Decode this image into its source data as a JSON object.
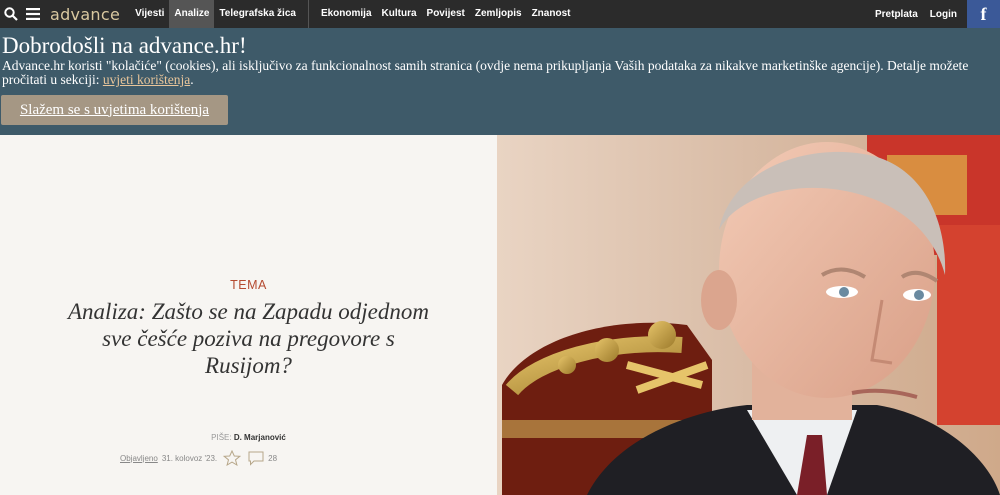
{
  "header": {
    "logo": "advance",
    "nav_main": [
      "Vijesti",
      "Analize",
      "Telegrafska žica"
    ],
    "nav_sections": [
      "Ekonomija",
      "Kultura",
      "Povijest",
      "Zemljopis",
      "Znanost"
    ],
    "nav_right": [
      "Pretplata",
      "Login"
    ],
    "facebook": "f"
  },
  "cookie": {
    "title": "Dobrodošli na advance.hr!",
    "text": "Advance.hr koristi \"kolačiće\" (cookies), ali isključivo za funkcionalnost samih stranica (ovdje nema prikupljanja Vaših podataka za nikakve marketinške agencije). Detalje možete pročitati u sekciji: ",
    "link": "uvjeti korištenja",
    "text_end": ".",
    "button": "Slažem se s uvjetima korištenja"
  },
  "article": {
    "tag": "TEMA",
    "headline": "Analiza: Zašto se na Zapadu odjednom sve češće poziva na pregovore s Rusijom?",
    "author_label": "PIŠE:",
    "author": "D. Marjanović",
    "published_label": "Objavljeno",
    "date": "31. kolovoz '23.",
    "comments": "28"
  },
  "colors": {
    "topbar": "#2b2b2b",
    "cookie_bg": "#3e5a69",
    "button_bg": "#a59784",
    "accent": "#b54b31",
    "facebook": "#3b5998"
  }
}
